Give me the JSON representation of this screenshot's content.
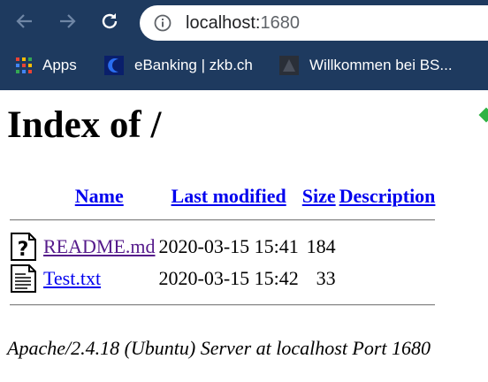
{
  "browser": {
    "url_host": "localhost:",
    "url_port": "1680",
    "bookmarks": [
      {
        "label": "Apps",
        "icon": "apps-grid-icon"
      },
      {
        "label": "eBanking | zkb.ch",
        "icon": "zkb-logo-icon"
      },
      {
        "label": "Willkommen bei BS...",
        "icon": "bs-favicon-icon"
      }
    ],
    "colors": {
      "toolbar": "#1e3a5f",
      "omnibox": "#ffffff"
    }
  },
  "page": {
    "title": "Index of /",
    "columns": {
      "name": "Name",
      "last_modified": "Last modified",
      "size": "Size",
      "description": "Description"
    },
    "rows": [
      {
        "name": "README.md",
        "modified": "2020-03-15 15:41",
        "size": "184",
        "description": "",
        "icon": "unknown-file-icon",
        "visited": true
      },
      {
        "name": "Test.txt",
        "modified": "2020-03-15 15:42",
        "size": "33",
        "description": "",
        "icon": "text-file-icon",
        "visited": false
      }
    ],
    "footer": "Apache/2.4.18 (Ubuntu) Server at localhost Port 1680"
  }
}
